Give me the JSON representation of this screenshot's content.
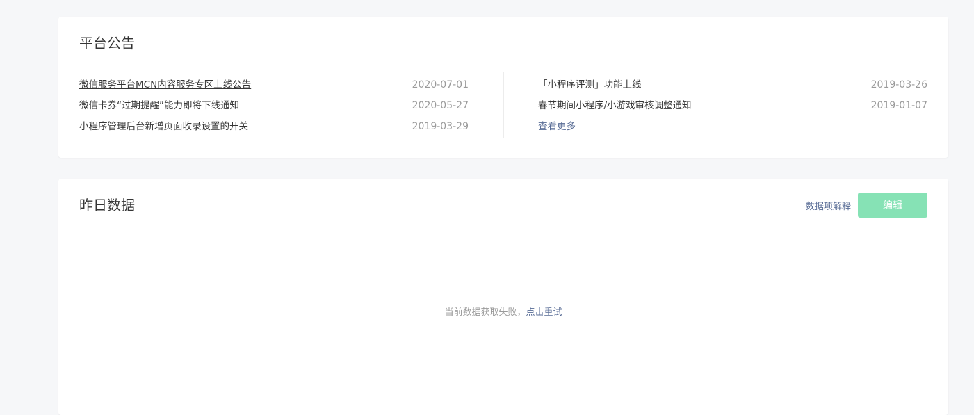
{
  "notice": {
    "title": "平台公告",
    "left": [
      {
        "title": "微信服务平台MCN内容服务专区上线公告",
        "date": "2020-07-01"
      },
      {
        "title": "微信卡券“过期提醒”能力即将下线通知",
        "date": "2020-05-27"
      },
      {
        "title": "小程序管理后台新增页面收录设置的开关",
        "date": "2019-03-29"
      }
    ],
    "right": [
      {
        "title": "「小程序评测」功能上线",
        "date": "2019-03-26"
      },
      {
        "title": "春节期间小程序/小游戏审核调整通知",
        "date": "2019-01-07"
      }
    ],
    "more_label": "查看更多"
  },
  "yesterday": {
    "title": "昨日数据",
    "explain_label": "数据项解释",
    "edit_label": "编辑",
    "error_text": "当前数据获取失败，",
    "retry_label": "点击重试"
  },
  "colors": {
    "link": "#576b95",
    "edit_button_disabled": "#86e2b5",
    "date": "#9a9a9a"
  }
}
